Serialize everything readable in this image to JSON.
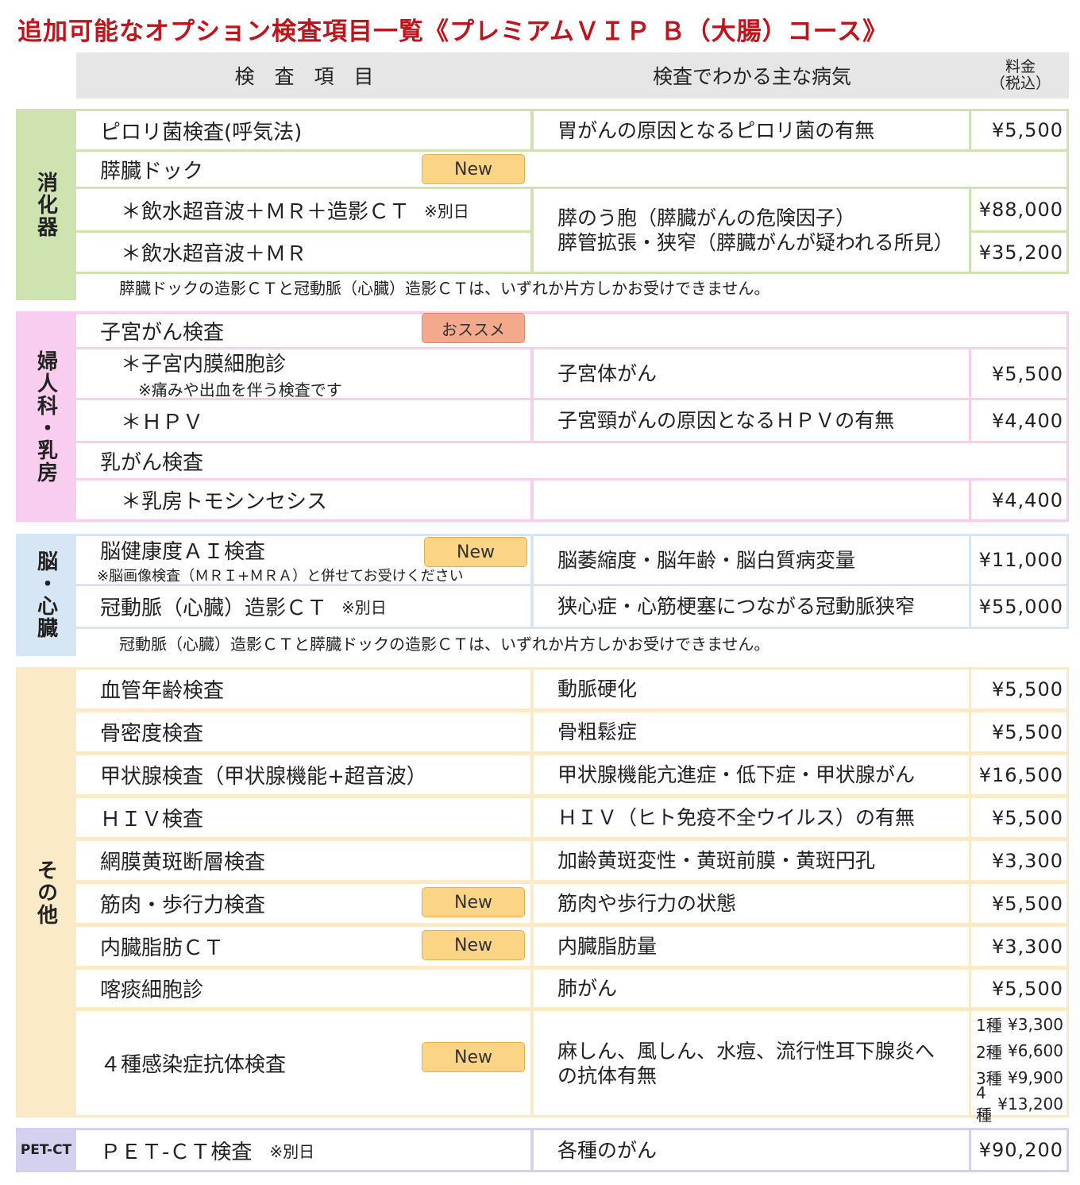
{
  "title": "追加可能なオプション検査項目一覧《プレミアムＶＩＰ Ｂ（大腸）コース》",
  "header": {
    "col_item": "検　査　項　目",
    "col_disease": "検査でわかる主な病気",
    "col_fee_line1": "料金",
    "col_fee_line2": "（税込）"
  },
  "colors": {
    "digestive": "#cfe3b0",
    "gyn": "#f8cdf0",
    "brain": "#d7e6f4",
    "other": "#faeac8",
    "pet": "#d4d0ef",
    "title": "#c0141c",
    "badge_new": "#fcd486",
    "badge_rec": "#f4a98c"
  },
  "badges": {
    "new": "New",
    "recommend": "おススメ"
  },
  "sections": {
    "digestive": {
      "label": "消化器",
      "pylori": {
        "item": "ピロリ菌検査(呼気法)",
        "disease": "胃がんの原因となるピロリ菌の有無",
        "fee": "¥5,500"
      },
      "pancreas": {
        "item": "膵臓ドック"
      },
      "pancreas_a": {
        "item": "＊飲水超音波＋ＭＲ＋造影ＣＴ",
        "tag": "※別日",
        "fee": "¥88,000"
      },
      "pancreas_b": {
        "item": "＊飲水超音波＋ＭＲ",
        "fee": "¥35,200"
      },
      "pancreas_disease_1": "膵のう胞（膵臓がんの危険因子）",
      "pancreas_disease_2": "膵管拡張・狭窄（膵臓がんが疑われる所見）",
      "note": "膵臓ドックの造影ＣＴと冠動脈（心臓）造影ＣＴは、いずれか片方しかお受けできません。"
    },
    "gyn": {
      "label": "婦人科・乳房",
      "uterus": {
        "item": "子宮がん検査"
      },
      "endometrium": {
        "item": "＊子宮内膜細胞診",
        "sub": "※痛みや出血を伴う検査です",
        "disease": "子宮体がん",
        "fee": "¥5,500"
      },
      "hpv": {
        "item": "＊ＨＰＶ",
        "disease": "子宮頸がんの原因となるＨＰＶの有無",
        "fee": "¥4,400"
      },
      "breast": {
        "item": "乳がん検査"
      },
      "tomo": {
        "item": "＊乳房トモシンセシス",
        "fee": "¥4,400"
      }
    },
    "brain": {
      "label": "脳・心臓",
      "ai": {
        "item": "脳健康度ＡＩ検査",
        "sub": "※脳画像検査（ＭＲＩ+ＭＲＡ）と併せてお受けください",
        "disease": "脳萎縮度・脳年齢・脳白質病変量",
        "fee": "¥11,000"
      },
      "coronary": {
        "item": "冠動脈（心臓）造影ＣＴ",
        "tag": "※別日",
        "disease": "狭心症・心筋梗塞につながる冠動脈狭窄",
        "fee": "¥55,000"
      },
      "note": "冠動脈（心臓）造影ＣＴと膵臓ドックの造影ＣＴは、いずれか片方しかお受けできません。"
    },
    "other": {
      "label": "その他",
      "rows": [
        {
          "item": "血管年齢検査",
          "disease": "動脈硬化",
          "fee": "¥5,500"
        },
        {
          "item": "骨密度検査",
          "disease": "骨粗鬆症",
          "fee": "¥5,500"
        },
        {
          "item": "甲状腺検査（甲状腺機能+超音波）",
          "disease": "甲状腺機能亢進症・低下症・甲状腺がん",
          "fee": "¥16,500"
        },
        {
          "item": "ＨＩＶ検査",
          "disease": "ＨＩＶ（ヒト免疫不全ウイルス）の有無",
          "fee": "¥5,500"
        },
        {
          "item": "網膜黄斑断層検査",
          "disease": "加齢黄斑変性・黄斑前膜・黄斑円孔",
          "fee": "¥3,300"
        },
        {
          "item": "筋肉・歩行力検査",
          "disease": "筋肉や歩行力の状態",
          "fee": "¥5,500"
        },
        {
          "item": "内臓脂肪ＣＴ",
          "disease": "内臓脂肪量",
          "fee": "¥3,300"
        },
        {
          "item": "喀痰細胞診",
          "disease": "肺がん",
          "fee": "¥5,500"
        }
      ],
      "infection": {
        "item": "４種感染症抗体検査",
        "disease": "麻しん、風しん、水痘、流行性耳下腺炎への抗体有無",
        "fees": [
          {
            "n": "1種",
            "fee": "¥3,300"
          },
          {
            "n": "2種",
            "fee": "¥6,600"
          },
          {
            "n": "3種",
            "fee": "¥9,900"
          },
          {
            "n": "4種",
            "fee": "¥13,200"
          }
        ]
      }
    },
    "pet": {
      "label": "PET-CT",
      "item": "ＰＥＴ-ＣＴ検査",
      "tag": "※別日",
      "disease": "各種のがん",
      "fee": "¥90,200"
    }
  }
}
